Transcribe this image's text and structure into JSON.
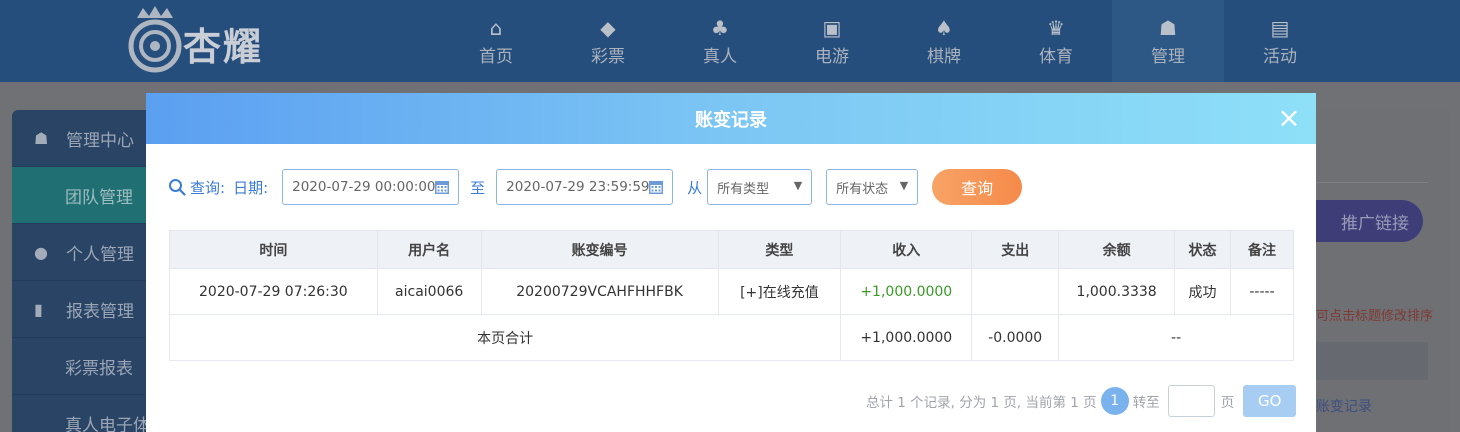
{
  "header": {
    "logo_text": "杏耀",
    "nav": [
      {
        "label": "首页",
        "icon": "home-icon"
      },
      {
        "label": "彩票",
        "icon": "lottery-icon"
      },
      {
        "label": "真人",
        "icon": "live-dealer-icon"
      },
      {
        "label": "电游",
        "icon": "slot-game-icon"
      },
      {
        "label": "棋牌",
        "icon": "cards-icon"
      },
      {
        "label": "体育",
        "icon": "trophy-icon"
      },
      {
        "label": "管理",
        "icon": "users-icon"
      },
      {
        "label": "活动",
        "icon": "gift-icon"
      }
    ]
  },
  "sidebar": {
    "items": [
      {
        "label": "管理中心",
        "icon": "users-icon"
      },
      {
        "label": "团队管理"
      },
      {
        "label": "个人管理",
        "icon": "user-icon"
      },
      {
        "label": "报表管理",
        "icon": "report-icon"
      },
      {
        "label": "彩票报表"
      },
      {
        "label": "真人电子体"
      }
    ]
  },
  "background": {
    "promo_button": "推广链接",
    "sort_hint": "可点击标题修改排序",
    "link": "账变记录"
  },
  "modal": {
    "title": "账变记录",
    "close_label": "×",
    "query_label": "查询:",
    "date_label": "日期:",
    "date_start": "2020-07-29 00:00:00",
    "to_label": "至",
    "date_end": "2020-07-29 23:59:59",
    "from_label": "从",
    "type_select": "所有类型",
    "status_select": "所有状态",
    "query_button": "查询",
    "table": {
      "headers": [
        "时间",
        "用户名",
        "账变编号",
        "类型",
        "收入",
        "支出",
        "余额",
        "状态",
        "备注"
      ],
      "rows": [
        [
          "2020-07-29 07:26:30",
          "aicai0066",
          "20200729VCAHFHHFBK",
          "[+]在线充值",
          "+1,000.0000",
          "",
          "1,000.3338",
          "成功",
          "-----"
        ]
      ],
      "total": {
        "label": "本页合计",
        "income": "+1,000.0000",
        "expense": "-0.0000",
        "balance": "--"
      }
    },
    "pager": {
      "summary": "总计 1 个记录, 分为 1 页, 当前第 1 页",
      "current_page": "1",
      "goto_label": "转至",
      "page_label": "页",
      "go_button": "GO"
    }
  },
  "colors": {
    "accent": "#3b7cd6",
    "income_green": "#3a9a28",
    "query_button": "#f58a4a"
  }
}
